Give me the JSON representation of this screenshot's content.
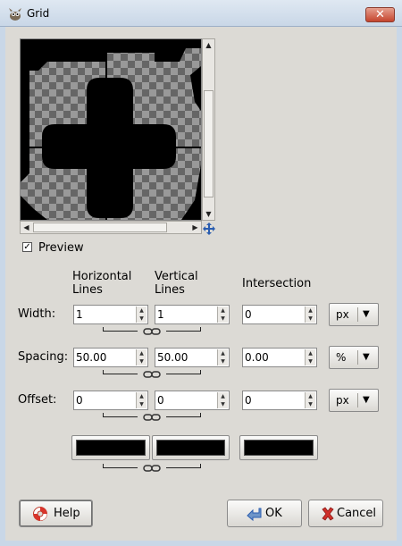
{
  "window": {
    "title": "Grid",
    "close_glyph": "✕",
    "icon": "gimp-icon"
  },
  "preview": {
    "checkbox_checked": true,
    "checkbox_label": "Preview",
    "checkbox_mark": "✓"
  },
  "columns": {
    "horizontal": [
      "Horizontal",
      "Lines"
    ],
    "vertical": [
      "Vertical",
      "Lines"
    ],
    "intersection": "Intersection"
  },
  "rows": {
    "width": {
      "label": "Width:",
      "horizontal": "1",
      "vertical": "1",
      "intersection": "0",
      "unit": "px"
    },
    "spacing": {
      "label": "Spacing:",
      "horizontal": "50.00",
      "vertical": "50.00",
      "intersection": "0.00",
      "unit": "%"
    },
    "offset": {
      "label": "Offset:",
      "horizontal": "0",
      "vertical": "0",
      "intersection": "0",
      "unit": "px"
    }
  },
  "colors": {
    "horizontal": "#000000",
    "vertical": "#000000",
    "intersection": "#000000"
  },
  "buttons": {
    "help": "Help",
    "ok": "OK",
    "cancel": "Cancel"
  },
  "accent": {
    "checker_light": "#999999",
    "checker_dark": "#666666",
    "dialog_bg": "#dcdad5"
  }
}
